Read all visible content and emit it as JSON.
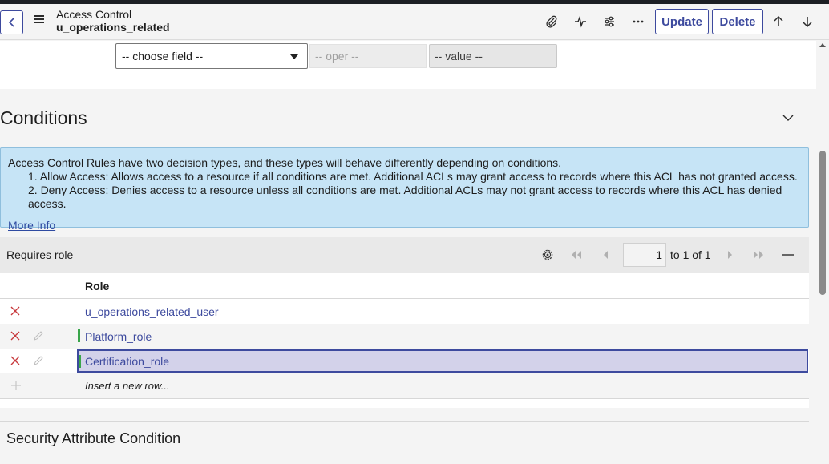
{
  "header": {
    "title": "Access Control",
    "subtitle": "u_operations_related",
    "update_label": "Update",
    "delete_label": "Delete"
  },
  "condition_builder": {
    "field_placeholder": "-- choose field --",
    "oper_placeholder": "-- oper --",
    "value_placeholder": "-- value --"
  },
  "conditions": {
    "title": "Conditions",
    "info_lines": [
      "Access Control Rules have two decision types, and these types will behave differently depending on conditions.",
      "1. Allow Access: Allows access to a resource if all conditions are met. Additional ACLs may grant access to records where this ACL has not granted access.",
      "2. Deny Access: Denies access to a resource unless all conditions are met. Additional ACLs may not grant access to records where this ACL has denied access."
    ],
    "more_info": "More Info"
  },
  "requires_role": {
    "title": "Requires role",
    "page_value": "1",
    "page_of": "to 1 of 1",
    "column": "Role",
    "rows": [
      "u_operations_related_user",
      "Platform_role",
      "Certification_role"
    ],
    "insert_label": "Insert a new row..."
  },
  "security_attribute": {
    "title": "Security Attribute Condition"
  },
  "colors": {
    "accent": "#3d4a9e",
    "info_bg": "#c6e4f6",
    "remove_red": "#c8383b",
    "changed_green": "#39a54a"
  }
}
